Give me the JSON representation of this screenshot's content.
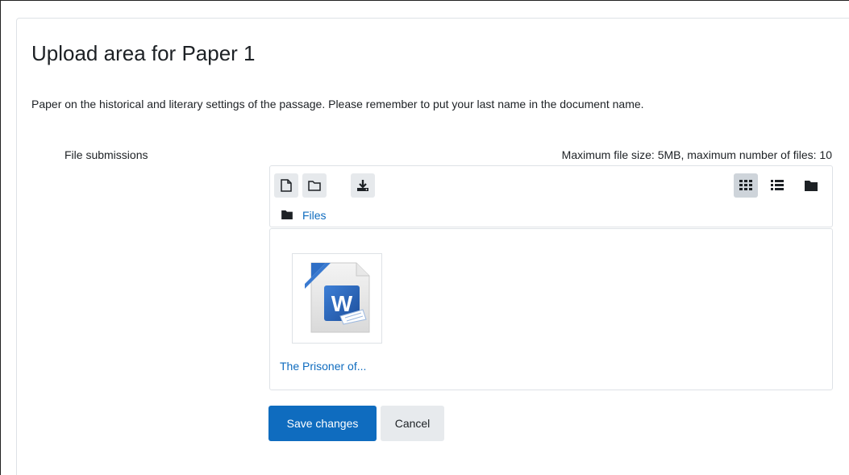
{
  "page": {
    "title": "Upload area for Paper 1",
    "intro": "Paper on the historical and literary settings of the passage. Please remember to put your last name in the document name."
  },
  "field": {
    "label": "File submissions",
    "limits": "Maximum file size: 5MB, maximum number of files: 10"
  },
  "filepicker": {
    "toolbar_left": [
      {
        "icon": "file-icon",
        "label": "Add..."
      },
      {
        "icon": "folder-icon",
        "label": "Create folder"
      },
      {
        "icon": "download-icon",
        "label": "Download"
      }
    ],
    "toolbar_right": [
      {
        "icon": "grid-view-icon",
        "active": true
      },
      {
        "icon": "list-view-icon",
        "active": false
      },
      {
        "icon": "tree-view-icon",
        "active": false
      }
    ],
    "breadcrumb": "Files",
    "files": [
      {
        "name": "The Prisoner of...",
        "icon": "word-document-icon"
      }
    ]
  },
  "actions": {
    "save_label": "Save changes",
    "cancel_label": "Cancel"
  },
  "colors": {
    "primary": "#0f6cbf",
    "link": "#0f6cbf",
    "border": "#dee2e6",
    "secondary_button": "#e7eaed",
    "active_toggle": "#ced4da"
  }
}
